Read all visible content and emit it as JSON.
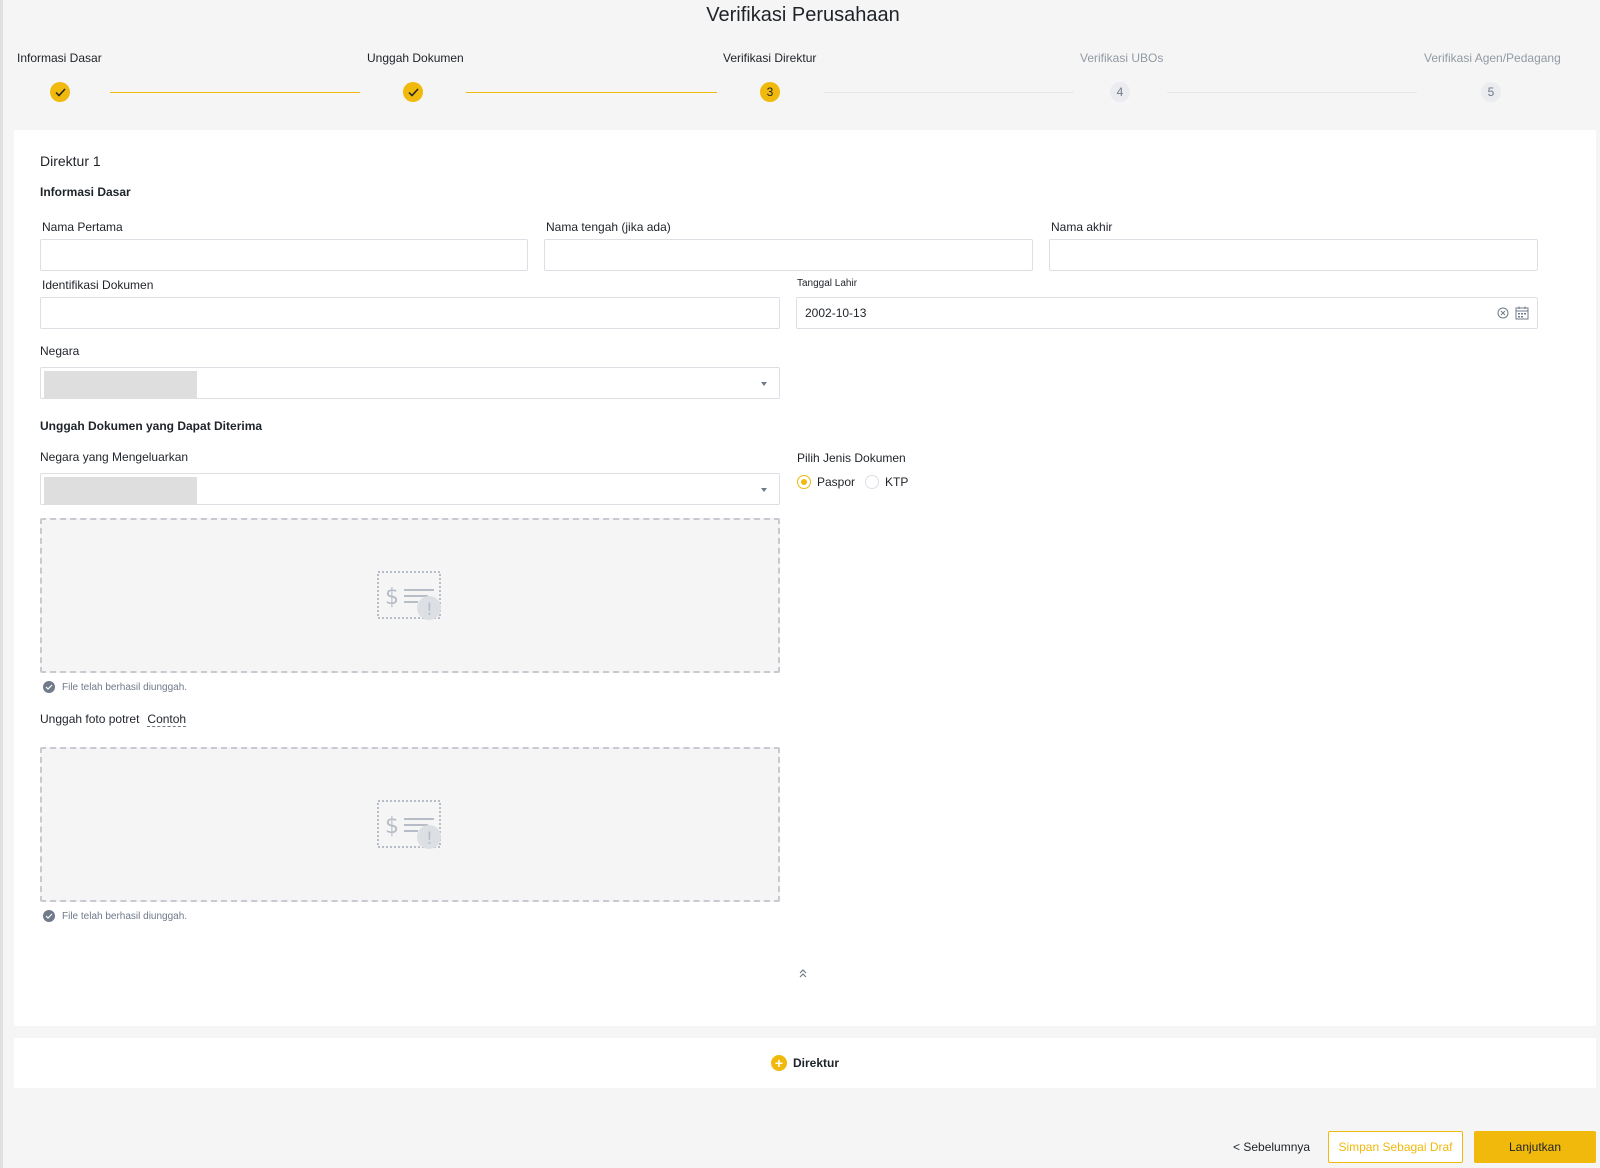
{
  "page": {
    "title": "Verifikasi Perusahaan"
  },
  "steps": [
    {
      "label": "Informasi Dasar",
      "status": "done",
      "marker": ""
    },
    {
      "label": "Unggah Dokumen",
      "status": "done",
      "marker": ""
    },
    {
      "label": "Verifikasi Direktur",
      "status": "active",
      "marker": "3"
    },
    {
      "label": "Verifikasi UBOs",
      "status": "pending",
      "marker": "4"
    },
    {
      "label": "Verifikasi Agen/Pedagang",
      "status": "pending",
      "marker": "5"
    }
  ],
  "director": {
    "title": "Direktur 1",
    "basic_info_title": "Informasi Dasar",
    "first_name": {
      "label": "Nama Pertama",
      "value": ""
    },
    "middle_name": {
      "label": "Nama tengah (jika ada)",
      "value": ""
    },
    "last_name": {
      "label": "Nama akhir",
      "value": ""
    },
    "id_document": {
      "label": "Identifikasi Dokumen",
      "value": ""
    },
    "birth_date": {
      "label": "Tanggal Lahir",
      "value": "2002-10-13"
    },
    "country": {
      "label": "Negara",
      "value": ""
    },
    "upload_title": "Unggah Dokumen yang Dapat Diterima",
    "issuing_country": {
      "label": "Negara yang Mengeluarkan",
      "value": ""
    },
    "doc_type": {
      "label": "Pilih Jenis Dokumen",
      "options": [
        "Paspor",
        "KTP"
      ],
      "selected": "Paspor"
    },
    "upload_status": "File telah berhasil diunggah.",
    "portrait": {
      "label": "Unggah foto potret",
      "example": "Contoh"
    },
    "portrait_status": "File telah berhasil diunggah."
  },
  "add_director": {
    "label": "Direktur"
  },
  "footer": {
    "prev_label": "< Sebelumnya",
    "draft_label": "Simpan Sebagai Draf",
    "next_label": "Lanjutkan"
  },
  "colors": {
    "accent": "#f0b90b",
    "text": "#1e2329",
    "muted": "#707a8a"
  },
  "icons": [
    "check-icon",
    "clear-icon",
    "calendar-icon",
    "caret-down-icon",
    "document-upload-icon",
    "success-check-icon",
    "collapse-up-icon",
    "plus-icon"
  ]
}
